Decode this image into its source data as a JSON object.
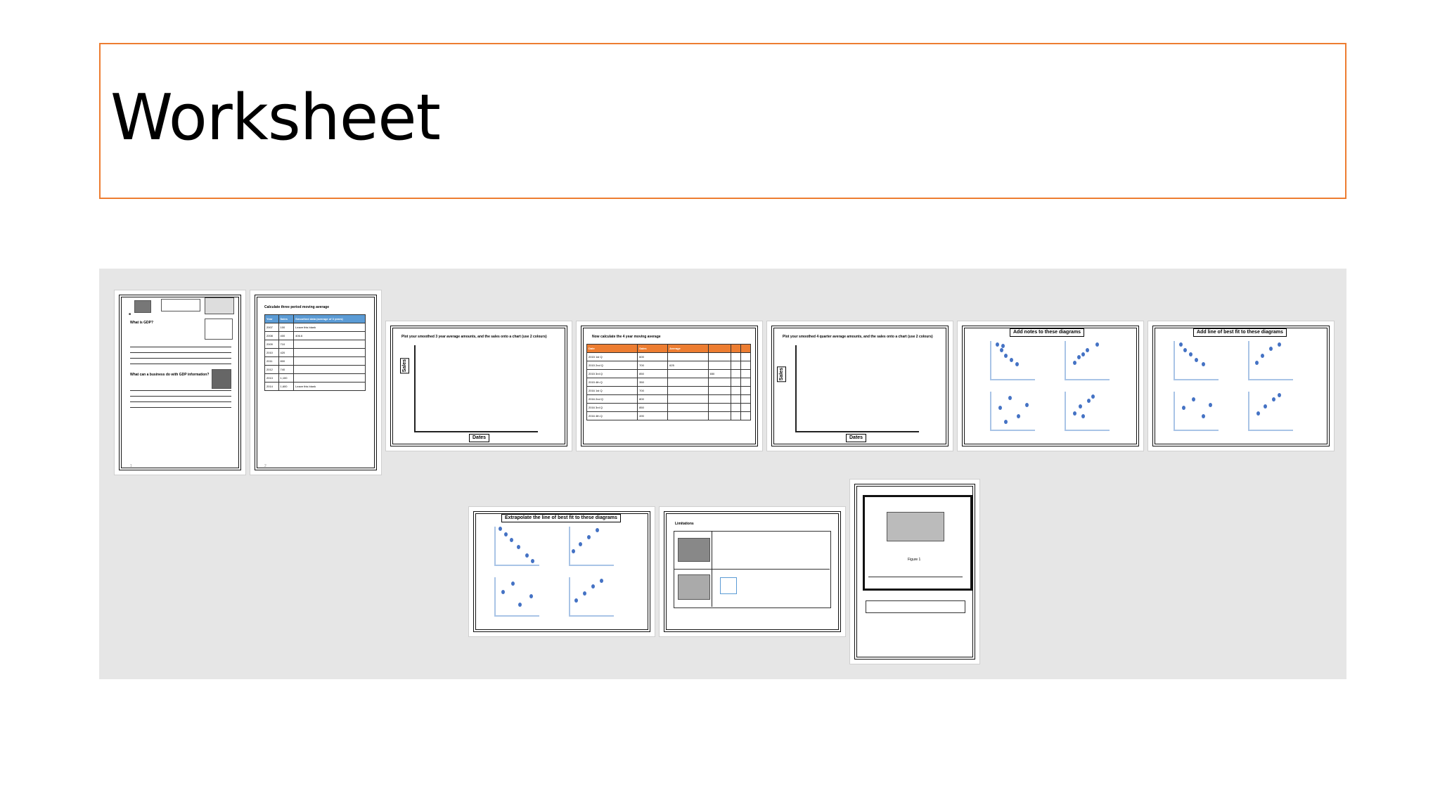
{
  "title": "Worksheet",
  "slides": {
    "s1": {
      "heading": "What is GDP?",
      "question": "What can a business do with GDP information?",
      "page": "1"
    },
    "s2": {
      "heading": "Calculate three period moving average",
      "headers": [
        "Year",
        "Sales",
        "Smoothed data (average of 3 years)"
      ],
      "rows": [
        [
          "2007",
          "100",
          "Leave this blank"
        ],
        [
          "2008",
          "400",
          "406.6"
        ],
        [
          "2009",
          "710",
          ""
        ],
        [
          "2010",
          "420",
          ""
        ],
        [
          "2011",
          "800",
          ""
        ],
        [
          "2012",
          "740",
          ""
        ],
        [
          "2013",
          "1,100",
          ""
        ],
        [
          "2014",
          "1,600",
          "Leave this blank"
        ]
      ],
      "page": "2"
    },
    "s3": {
      "heading": "Plot your smoothed 3 year average amounts, and the sales onto a chart (use 2 colours)",
      "ylabel": "Sales",
      "xlabel": "Dates"
    },
    "s4": {
      "heading": "Now calculate the 4 year moving average",
      "headers": [
        "Date",
        "Sales",
        "Average"
      ],
      "rows": [
        [
          "2015 1st Q",
          "600"
        ],
        [
          "2015 2nd Q",
          "700"
        ],
        [
          "2015 3rd Q",
          "850"
        ],
        [
          "2015 4th Q",
          "350"
        ],
        [
          "2016 1st Q",
          "700"
        ],
        [
          "2016 2nd Q",
          "800"
        ],
        [
          "2016 3rd Q",
          "850"
        ],
        [
          "2016 4th Q",
          "490"
        ]
      ],
      "avg1": "625",
      "avg2": "650"
    },
    "s5": {
      "heading": "Plot your smoothed 4 quarter average amounts, and the sales onto a chart (use 2 colours)",
      "ylabel": "Sales",
      "xlabel": "Dates"
    },
    "s6": {
      "heading": "Add notes to these diagrams"
    },
    "s7": {
      "heading": "Add line of best fit to these diagrams"
    },
    "s8": {
      "heading": "Extrapolate the line of best fit to these diagrams"
    },
    "s9": {
      "heading": "Limitations"
    },
    "s10": {
      "heading": "Figure 1"
    }
  },
  "colors": {
    "title_border": "#ed7d31",
    "dot": "#4472c4",
    "table_header_blue": "#5b9bd5",
    "table_header_orange": "#ed7d31"
  }
}
